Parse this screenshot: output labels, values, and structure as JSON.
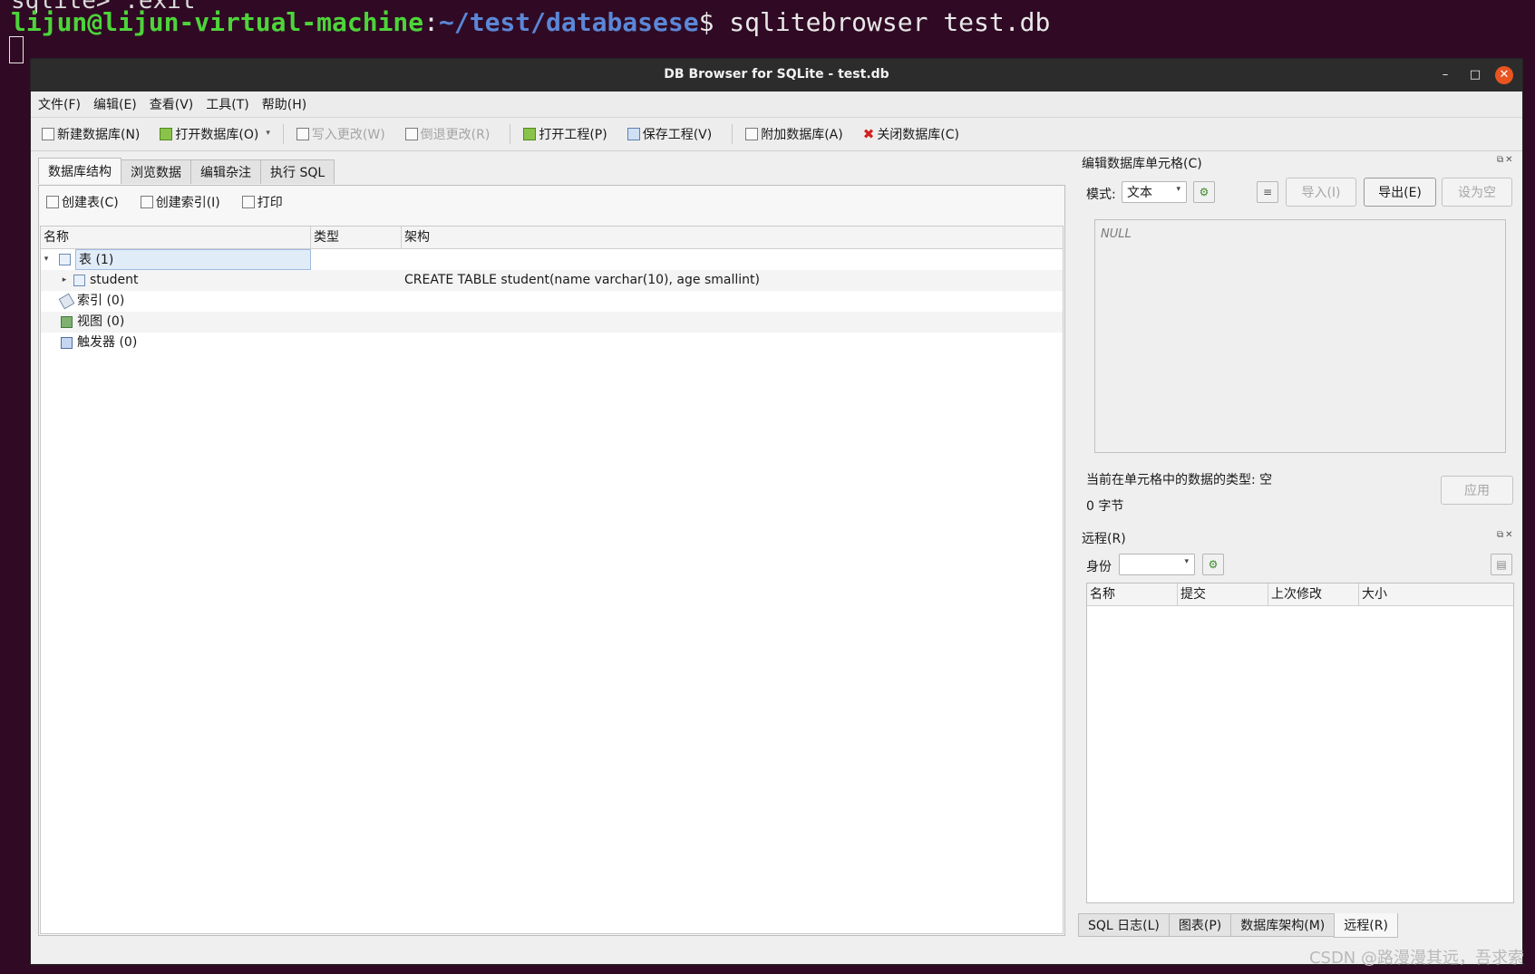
{
  "terminal": {
    "prev_line": "sqlite> .exit",
    "user_host": "lijun@lijun-virtual-machine",
    "colon": ":",
    "path": "~/test/databasese",
    "prompt": "$",
    "command": " sqlitebrowser test.db"
  },
  "window": {
    "title": "DB Browser for SQLite - test.db",
    "min_glyph": "–",
    "max_glyph": "□",
    "close_glyph": "✕"
  },
  "menu": [
    "文件(F)",
    "编辑(E)",
    "查看(V)",
    "工具(T)",
    "帮助(H)"
  ],
  "toolbar": {
    "new_db": "新建数据库(N)",
    "open_db": "打开数据库(O)",
    "write_changes": "写入更改(W)",
    "revert_changes": "倒退更改(R)",
    "open_project": "打开工程(P)",
    "save_project": "保存工程(V)",
    "attach_db": "附加数据库(A)",
    "close_db": "关闭数据库(C)"
  },
  "main_tabs": [
    "数据库结构",
    "浏览数据",
    "编辑杂注",
    "执行 SQL"
  ],
  "structure": {
    "create_table": "创建表(C)",
    "create_index": "创建索引(I)",
    "print": "打印",
    "columns": [
      "名称",
      "类型",
      "架构"
    ],
    "rows": [
      {
        "name": "表 (1)",
        "type": "",
        "schema": ""
      },
      {
        "name": "student",
        "type": "",
        "schema": "CREATE TABLE student(name varchar(10), age smallint)"
      },
      {
        "name": "索引 (0)",
        "type": "",
        "schema": ""
      },
      {
        "name": "视图 (0)",
        "type": "",
        "schema": ""
      },
      {
        "name": "触发器 (0)",
        "type": "",
        "schema": ""
      }
    ]
  },
  "edit_cell": {
    "title": "编辑数据库单元格(C)",
    "mode_label": "模式:",
    "mode_value": "文本",
    "import": "导入(I)",
    "export": "导出(E)",
    "set_null": "设为空",
    "editor_value": "NULL",
    "type_info": "当前在单元格中的数据的类型: 空",
    "size_info": "0 字节",
    "apply": "应用"
  },
  "remote": {
    "title": "远程(R)",
    "identity_label": "身份",
    "identity_value": "",
    "columns": [
      "名称",
      "提交",
      "上次修改",
      "大小"
    ]
  },
  "bottom_tabs": [
    "SQL 日志(L)",
    "图表(P)",
    "数据库架构(M)",
    "远程(R)"
  ],
  "watermark": "CSDN @路漫漫其远，吾求索"
}
